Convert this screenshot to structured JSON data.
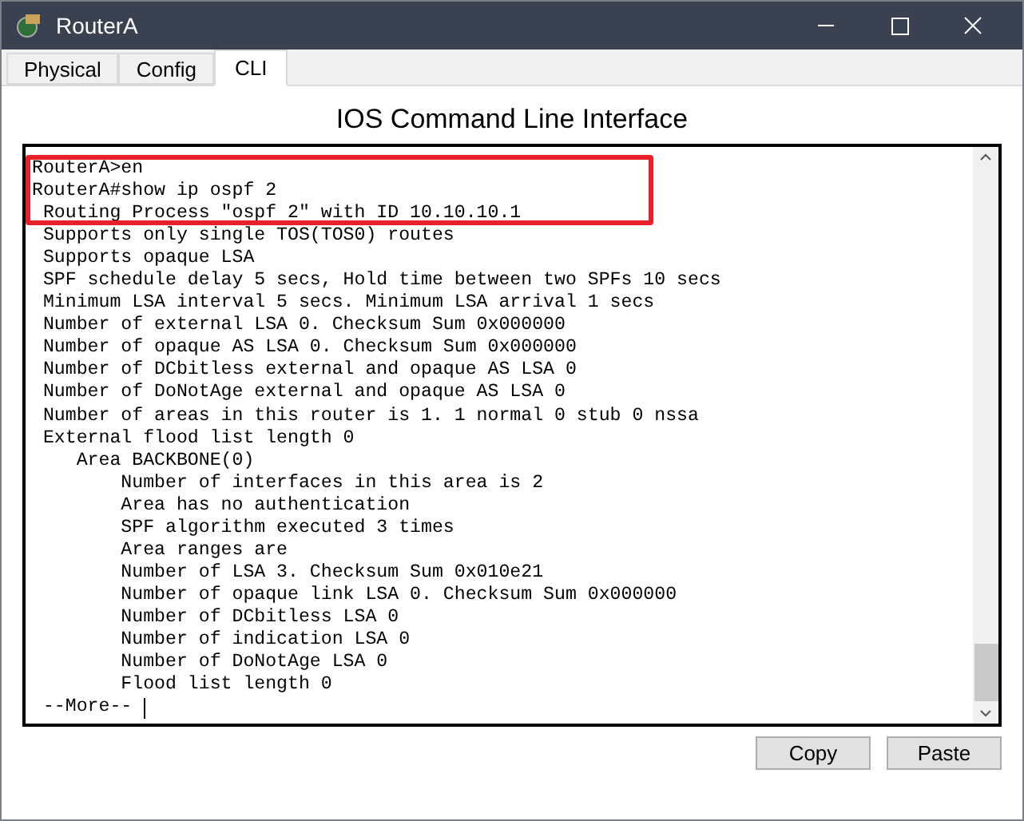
{
  "window": {
    "title": "RouterA"
  },
  "tabs": [
    {
      "label": "Physical",
      "selected": false
    },
    {
      "label": "Config",
      "selected": false
    },
    {
      "label": "CLI",
      "selected": true
    }
  ],
  "heading": "IOS Command Line Interface",
  "terminal": {
    "lines": [
      "RouterA>en",
      "RouterA#show ip ospf 2",
      " Routing Process \"ospf 2\" with ID 10.10.10.1",
      " Supports only single TOS(TOS0) routes",
      " Supports opaque LSA",
      " SPF schedule delay 5 secs, Hold time between two SPFs 10 secs",
      " Minimum LSA interval 5 secs. Minimum LSA arrival 1 secs",
      " Number of external LSA 0. Checksum Sum 0x000000",
      " Number of opaque AS LSA 0. Checksum Sum 0x000000",
      " Number of DCbitless external and opaque AS LSA 0",
      " Number of DoNotAge external and opaque AS LSA 0",
      " Number of areas in this router is 1. 1 normal 0 stub 0 nssa",
      " External flood list length 0",
      "    Area BACKBONE(0)",
      "        Number of interfaces in this area is 2",
      "        Area has no authentication",
      "        SPF algorithm executed 3 times",
      "        Area ranges are",
      "        Number of LSA 3. Checksum Sum 0x010e21",
      "        Number of opaque link LSA 0. Checksum Sum 0x000000",
      "        Number of DCbitless LSA 0",
      "        Number of indication LSA 0",
      "        Number of DoNotAge LSA 0",
      "        Flood list length 0"
    ],
    "prompt": " --More-- "
  },
  "buttons": [
    "Copy",
    "Paste"
  ]
}
